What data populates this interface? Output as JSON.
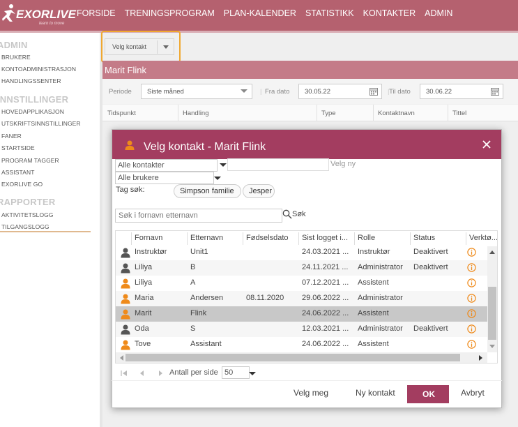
{
  "brand": {
    "logo_text": "EXORLIVE",
    "tagline": "learn to move"
  },
  "nav": {
    "items": [
      {
        "label": "FORSIDE"
      },
      {
        "label": "TRENINGSPROGRAM"
      },
      {
        "label": "PLAN-KALENDER"
      },
      {
        "label": "STATISTIKK"
      },
      {
        "label": "KONTAKTER"
      },
      {
        "label": "ADMIN",
        "active": true
      }
    ]
  },
  "sidebar": {
    "sections": [
      {
        "title": "ADMIN",
        "items": [
          "BRUKERE",
          "KONTOADMINISTRASJON",
          "HANDLINGSSENTER"
        ]
      },
      {
        "title": "INNSTILLINGER",
        "items": [
          "HOVEDAPPLIKASJON",
          "UTSKRIFTSINNSTILLINGER",
          "FANER",
          "STARTSIDE",
          "PROGRAM TAGGER",
          "ASSISTANT",
          "EXORLIVE GO"
        ]
      },
      {
        "title": "RAPPORTER",
        "items": [
          "AKTIVITETSLOGG",
          "TILGANGSLOGG"
        ]
      }
    ],
    "active_item": "TILGANGSLOGG"
  },
  "toolbar": {
    "velg_kontakt_label": "Velg kontakt"
  },
  "contact_band": {
    "name": "Marit Flink"
  },
  "filters": {
    "periode_label": "Periode",
    "periode_value": "Siste måned",
    "fra_label": "Fra dato",
    "fra_value": "30.05.22",
    "til_label": "Til dato",
    "til_value": "30.06.22"
  },
  "log_grid": {
    "columns": [
      "Tidspunkt",
      "Handling",
      "Type",
      "Kontaktnavn",
      "Tittel"
    ]
  },
  "dialog": {
    "title": "Velg kontakt - Marit Flink",
    "contacts_filter": "Alle kontakter",
    "velg_ny_placeholder": "Velg ny",
    "users_filter": "Alle brukere",
    "tag_search_label": "Tag søk:",
    "tags": [
      "Simpson familie",
      "Jesper"
    ],
    "search_placeholder": "Søk i fornavn etternavn",
    "search_button": "Søk",
    "columns": [
      "Fornavn",
      "Etternavn",
      "Fødselsdato",
      "Sist logget i...",
      "Rolle",
      "Status",
      "Verktø..."
    ],
    "rows": [
      {
        "fornavn": "Instruktør",
        "etternavn": "Unit1",
        "fodselsdato": "",
        "sist": "24.03.2021 ...",
        "rolle": "Instruktør",
        "status": "Deaktivert",
        "icon_color": "#555555"
      },
      {
        "fornavn": "Liliya",
        "etternavn": "B",
        "fodselsdato": "",
        "sist": "24.11.2021 ...",
        "rolle": "Administrator",
        "status": "Deaktivert",
        "icon_color": "#555555"
      },
      {
        "fornavn": "Liliya",
        "etternavn": "A",
        "fodselsdato": "",
        "sist": "07.12.2021 ...",
        "rolle": "Assistent",
        "status": "",
        "icon_color": "#ef8a1a"
      },
      {
        "fornavn": "Maria",
        "etternavn": "Andersen",
        "fodselsdato": "08.11.2020",
        "sist": "29.06.2022 ...",
        "rolle": "Administrator",
        "status": "",
        "icon_color": "#ef8a1a"
      },
      {
        "fornavn": "Marit",
        "etternavn": "Flink",
        "fodselsdato": "",
        "sist": "24.06.2022 ...",
        "rolle": "Assistent",
        "status": "",
        "icon_color": "#ef8a1a",
        "selected": true
      },
      {
        "fornavn": "Oda",
        "etternavn": "S",
        "fodselsdato": "",
        "sist": "12.03.2021 ...",
        "rolle": "Administrator",
        "status": "Deaktivert",
        "icon_color": "#555555"
      },
      {
        "fornavn": "Tove",
        "etternavn": "Assistant",
        "fodselsdato": "",
        "sist": "24.06.2022 ...",
        "rolle": "Assistent",
        "status": "",
        "icon_color": "#ef8a1a"
      }
    ],
    "pager": {
      "per_page_label": "Antall per side",
      "per_page_value": "50"
    },
    "footer": {
      "velg_meg": "Velg meg",
      "ny_kontakt": "Ny kontakt",
      "ok": "OK",
      "avbryt": "Avbryt"
    }
  },
  "colors": {
    "header": "#b5616f",
    "dialog_header": "#a33d60",
    "accent_orange": "#f0a830",
    "person_orange": "#ef8a1a",
    "info_orange": "#ef8a1a"
  }
}
